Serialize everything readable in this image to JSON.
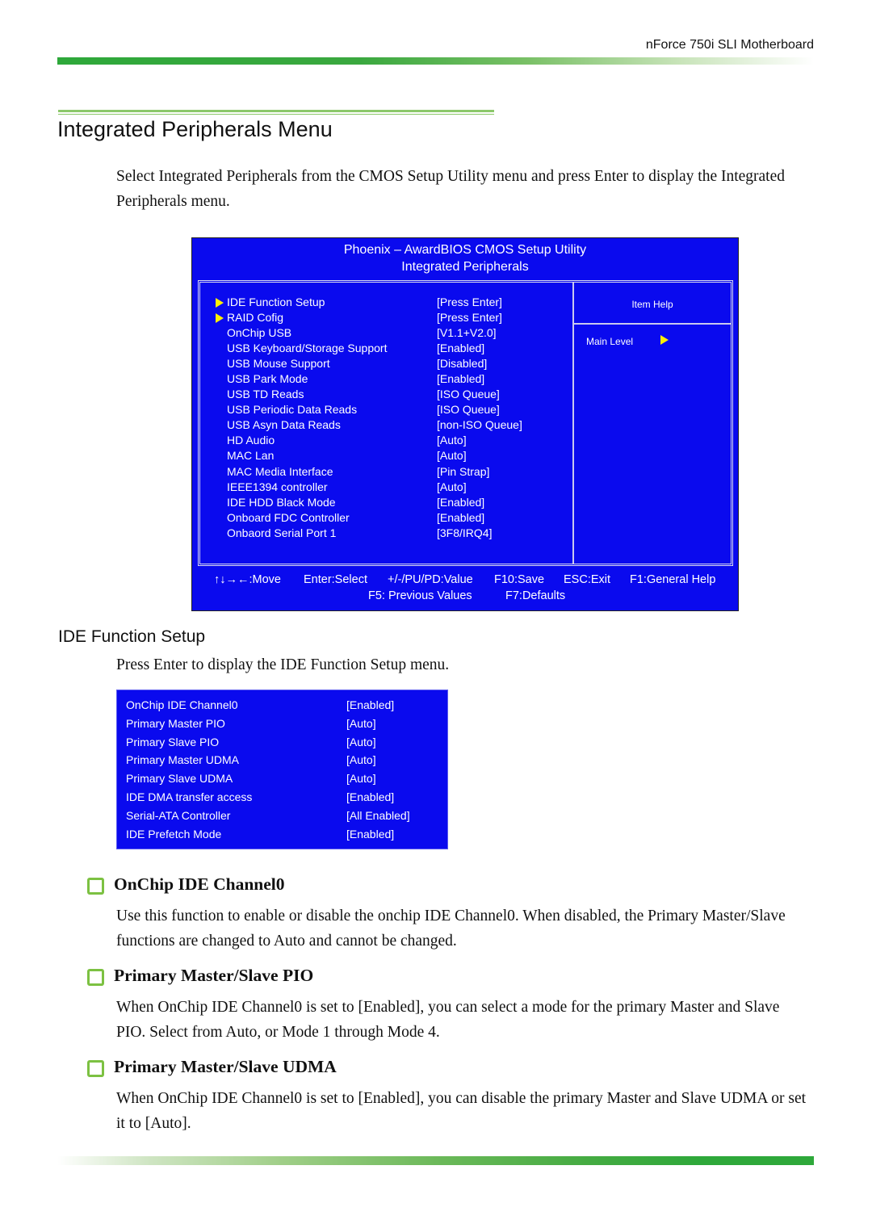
{
  "header": {
    "product": "nForce 750i SLI Motherboard"
  },
  "page_title": "Integrated Peripherals Menu",
  "intro": "Select Integrated Peripherals from the CMOS Setup Utility menu and press Enter to display the Integrated Peripherals menu.",
  "bios": {
    "title": "Phoenix – AwardBIOS CMOS Setup Utility",
    "subtitle": "Integrated Peripherals",
    "items": [
      {
        "label": "IDE Function Setup",
        "value": "[Press Enter]",
        "submenu": true
      },
      {
        "label": "RAID Cofig",
        "value": "[Press Enter]",
        "submenu": true
      },
      {
        "label": "OnChip USB",
        "value": "[V1.1+V2.0]",
        "submenu": false
      },
      {
        "label": "USB Keyboard/Storage Support",
        "value": "[Enabled]",
        "submenu": false
      },
      {
        "label": "USB Mouse Support",
        "value": "[Disabled]",
        "submenu": false
      },
      {
        "label": "USB Park Mode",
        "value": "[Enabled]",
        "submenu": false
      },
      {
        "label": "USB TD Reads",
        "value": "[ISO Queue]",
        "submenu": false
      },
      {
        "label": "USB Periodic Data Reads",
        "value": "[ISO Queue]",
        "submenu": false
      },
      {
        "label": "USB Asyn Data Reads",
        "value": "[non-ISO Queue]",
        "submenu": false
      },
      {
        "label": "HD Audio",
        "value": "[Auto]",
        "submenu": false
      },
      {
        "label": "MAC Lan",
        "value": "[Auto]",
        "submenu": false
      },
      {
        "label": "MAC Media Interface",
        "value": "[Pin Strap]",
        "submenu": false
      },
      {
        "label": "IEEE1394 controller",
        "value": "[Auto]",
        "submenu": false
      },
      {
        "label": "IDE HDD Black Mode",
        "value": "[Enabled]",
        "submenu": false
      },
      {
        "label": "Onboard FDC Controller",
        "value": "[Enabled]",
        "submenu": false
      },
      {
        "label": "Onbaord Serial Port 1",
        "value": "[3F8/IRQ4]",
        "submenu": false
      }
    ],
    "help": {
      "title": "Item Help",
      "main_level": "Main Level"
    },
    "footer": {
      "move": "↑↓→←:Move",
      "select": "Enter:Select",
      "value": "+/-/PU/PD:Value",
      "save": "F10:Save",
      "exit": "ESC:Exit",
      "help": "F1:General Help",
      "previous": "F5: Previous Values",
      "defaults": "F7:Defaults"
    },
    "colors": {
      "background": "#0a0aee",
      "text": "#ffffff",
      "arrow": "#ffee00"
    }
  },
  "ide_section": {
    "heading": "IDE Function Setup",
    "intro": "Press Enter to display the IDE Function Setup menu.",
    "items": [
      {
        "label": "OnChip IDE Channel0",
        "value": "[Enabled]"
      },
      {
        "label": "Primary Master PIO",
        "value": "[Auto]"
      },
      {
        "label": "Primary Slave PIO",
        "value": "[Auto]"
      },
      {
        "label": "Primary Master UDMA",
        "value": "[Auto]"
      },
      {
        "label": "Primary Slave UDMA",
        "value": "[Auto]"
      },
      {
        "label": "IDE DMA transfer access",
        "value": "[Enabled]"
      },
      {
        "label": "Serial-ATA Controller",
        "value": "[All Enabled]"
      },
      {
        "label": "IDE Prefetch Mode",
        "value": "[Enabled]"
      }
    ]
  },
  "options": [
    {
      "title": "OnChip IDE Channel0",
      "body": "Use this function to enable or disable the onchip IDE Channel0. When disabled, the Primary Master/Slave functions are changed to Auto and cannot be changed."
    },
    {
      "title": "Primary Master/Slave PIO",
      "body": "When OnChip IDE Channel0 is set to [Enabled], you can select a mode for the primary Master and Slave PIO. Select from Auto, or Mode 1 through Mode 4."
    },
    {
      "title": "Primary Master/Slave UDMA",
      "body": "When OnChip IDE Channel0 is set to [Enabled], you can disable the primary Master and Slave UDMA or set it to [Auto]."
    }
  ],
  "colors": {
    "accent_green": "#2ea83a",
    "rule_green": "#8cc86a",
    "checkbox_green": "#7cc142"
  }
}
